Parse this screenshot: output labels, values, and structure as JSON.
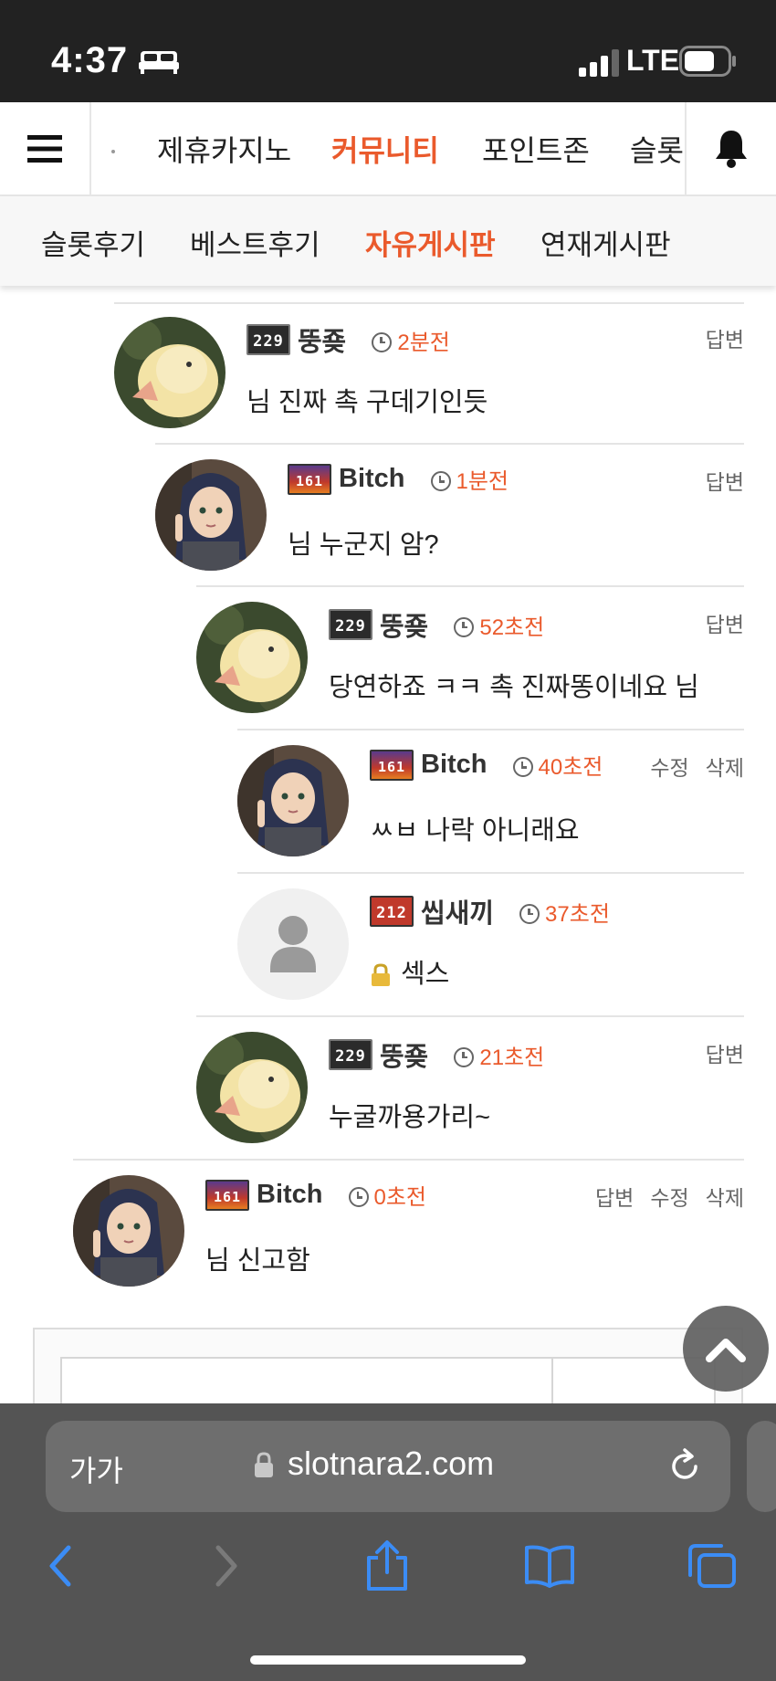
{
  "status_bar": {
    "time": "4:37",
    "network": "LTE"
  },
  "main_nav": {
    "items": [
      {
        "label": "제휴카지노",
        "active": false
      },
      {
        "label": "커뮤니티",
        "active": true
      },
      {
        "label": "포인트존",
        "active": false
      },
      {
        "label": "슬롯",
        "active": false
      }
    ]
  },
  "sub_nav": {
    "items": [
      {
        "label": "슬롯후기",
        "active": false
      },
      {
        "label": "베스트후기",
        "active": false
      },
      {
        "label": "자유게시판",
        "active": true
      },
      {
        "label": "연재게시판",
        "active": false
      }
    ]
  },
  "comments": [
    {
      "badge": "229",
      "nick": "뚱죶",
      "time": "2분전",
      "text": "님 진짜 촉 구데기인듯",
      "actions": [
        "답변"
      ]
    },
    {
      "badge": "161",
      "nick": "Bitch",
      "time": "1분전",
      "text": "님 누군지 암?",
      "actions": [
        "답변"
      ]
    },
    {
      "badge": "229",
      "nick": "뚱죶",
      "time": "52초전",
      "text": "당연하죠 ㅋㅋ 촉 진짜똥이네요 님",
      "actions": [
        "답변"
      ]
    },
    {
      "badge": "161",
      "nick": "Bitch",
      "time": "40초전",
      "text": "ㅆㅂ 나락 아니래요",
      "actions": [
        "수정",
        "삭제"
      ]
    },
    {
      "badge": "212",
      "nick": "씹새끼",
      "time": "37초전",
      "text": "섹스",
      "actions": []
    },
    {
      "badge": "229",
      "nick": "뚱죶",
      "time": "21초전",
      "text": "누굴까용가리~",
      "actions": [
        "답변"
      ]
    },
    {
      "badge": "161",
      "nick": "Bitch",
      "time": "0초전",
      "text": "님 신고함",
      "actions": [
        "답변",
        "수정",
        "삭제"
      ]
    }
  ],
  "browser": {
    "aa_label": "가가",
    "url": "slotnara2.com"
  },
  "icons": {
    "menu": "hamburger-icon",
    "notifications": "bell-icon",
    "clock": "clock-icon",
    "secret": "lock-icon",
    "scroll_top": "chevron-up-icon",
    "back": "chevron-left-icon",
    "forward": "chevron-right-icon",
    "share": "share-icon",
    "bookmarks": "book-icon",
    "tabs": "tabs-icon"
  },
  "colors": {
    "accent": "#ea5a2c",
    "safari_bar": "#545454",
    "ios_blue": "#3b8cf5"
  }
}
